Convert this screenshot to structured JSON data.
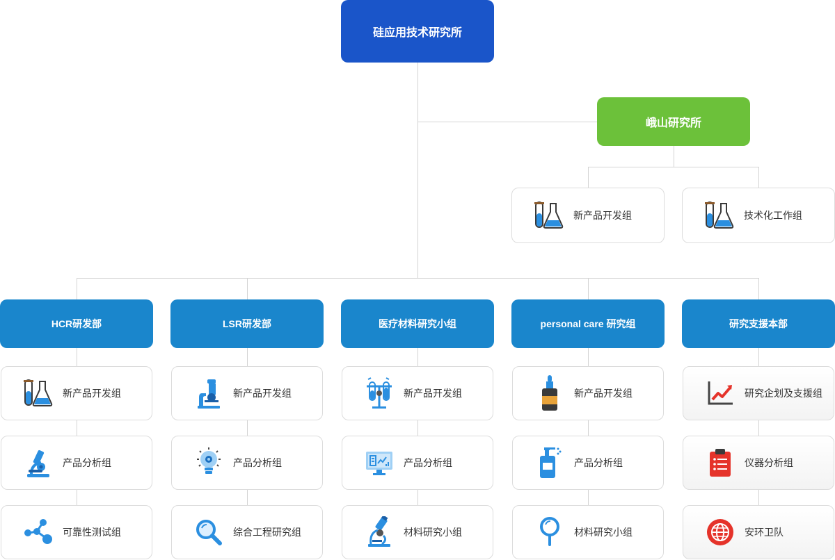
{
  "root": {
    "label": "硅应用技术研究所"
  },
  "branch": {
    "label": "峨山研究所",
    "groups": [
      {
        "label": "新产品开发组",
        "icon": "test-tube-flask-icon"
      },
      {
        "label": "技术化工作组",
        "icon": "test-tube-flask-icon"
      }
    ]
  },
  "departments": [
    {
      "label": "HCR研发部",
      "groups": [
        {
          "label": "新产品开发组",
          "icon": "test-tube-flask-icon"
        },
        {
          "label": "产品分析组",
          "icon": "microscope-icon"
        },
        {
          "label": "可靠性测试组",
          "icon": "molecule-icon"
        }
      ]
    },
    {
      "label": "LSR研发部",
      "groups": [
        {
          "label": "新产品开发组",
          "icon": "microscope-icon"
        },
        {
          "label": "产品分析组",
          "icon": "lightbulb-gear-icon"
        },
        {
          "label": "综合工程研究组",
          "icon": "magnifier-icon"
        }
      ]
    },
    {
      "label": "医疗材料研究小组",
      "groups": [
        {
          "label": "新产品开发组",
          "icon": "test-tubes-rack-icon"
        },
        {
          "label": "产品分析组",
          "icon": "monitor-analysis-icon"
        },
        {
          "label": "材料研究小组",
          "icon": "microscope-icon"
        }
      ]
    },
    {
      "label": "personal care 研究组",
      "groups": [
        {
          "label": "新产品开发组",
          "icon": "dropper-bottle-icon"
        },
        {
          "label": "产品分析组",
          "icon": "spray-bottle-icon"
        },
        {
          "label": "材料研究小组",
          "icon": "magnifier-icon"
        }
      ]
    },
    {
      "label": "研究支援本部",
      "groups": [
        {
          "label": "研究企划及支援组",
          "icon": "line-chart-icon"
        },
        {
          "label": "仪器分析组",
          "icon": "clipboard-icon"
        },
        {
          "label": "安环卫队",
          "icon": "globe-icon"
        }
      ]
    }
  ],
  "colors": {
    "root": "#1a55c9",
    "branch": "#6cc13a",
    "department": "#1a86cc",
    "line": "#d3d3d3"
  }
}
